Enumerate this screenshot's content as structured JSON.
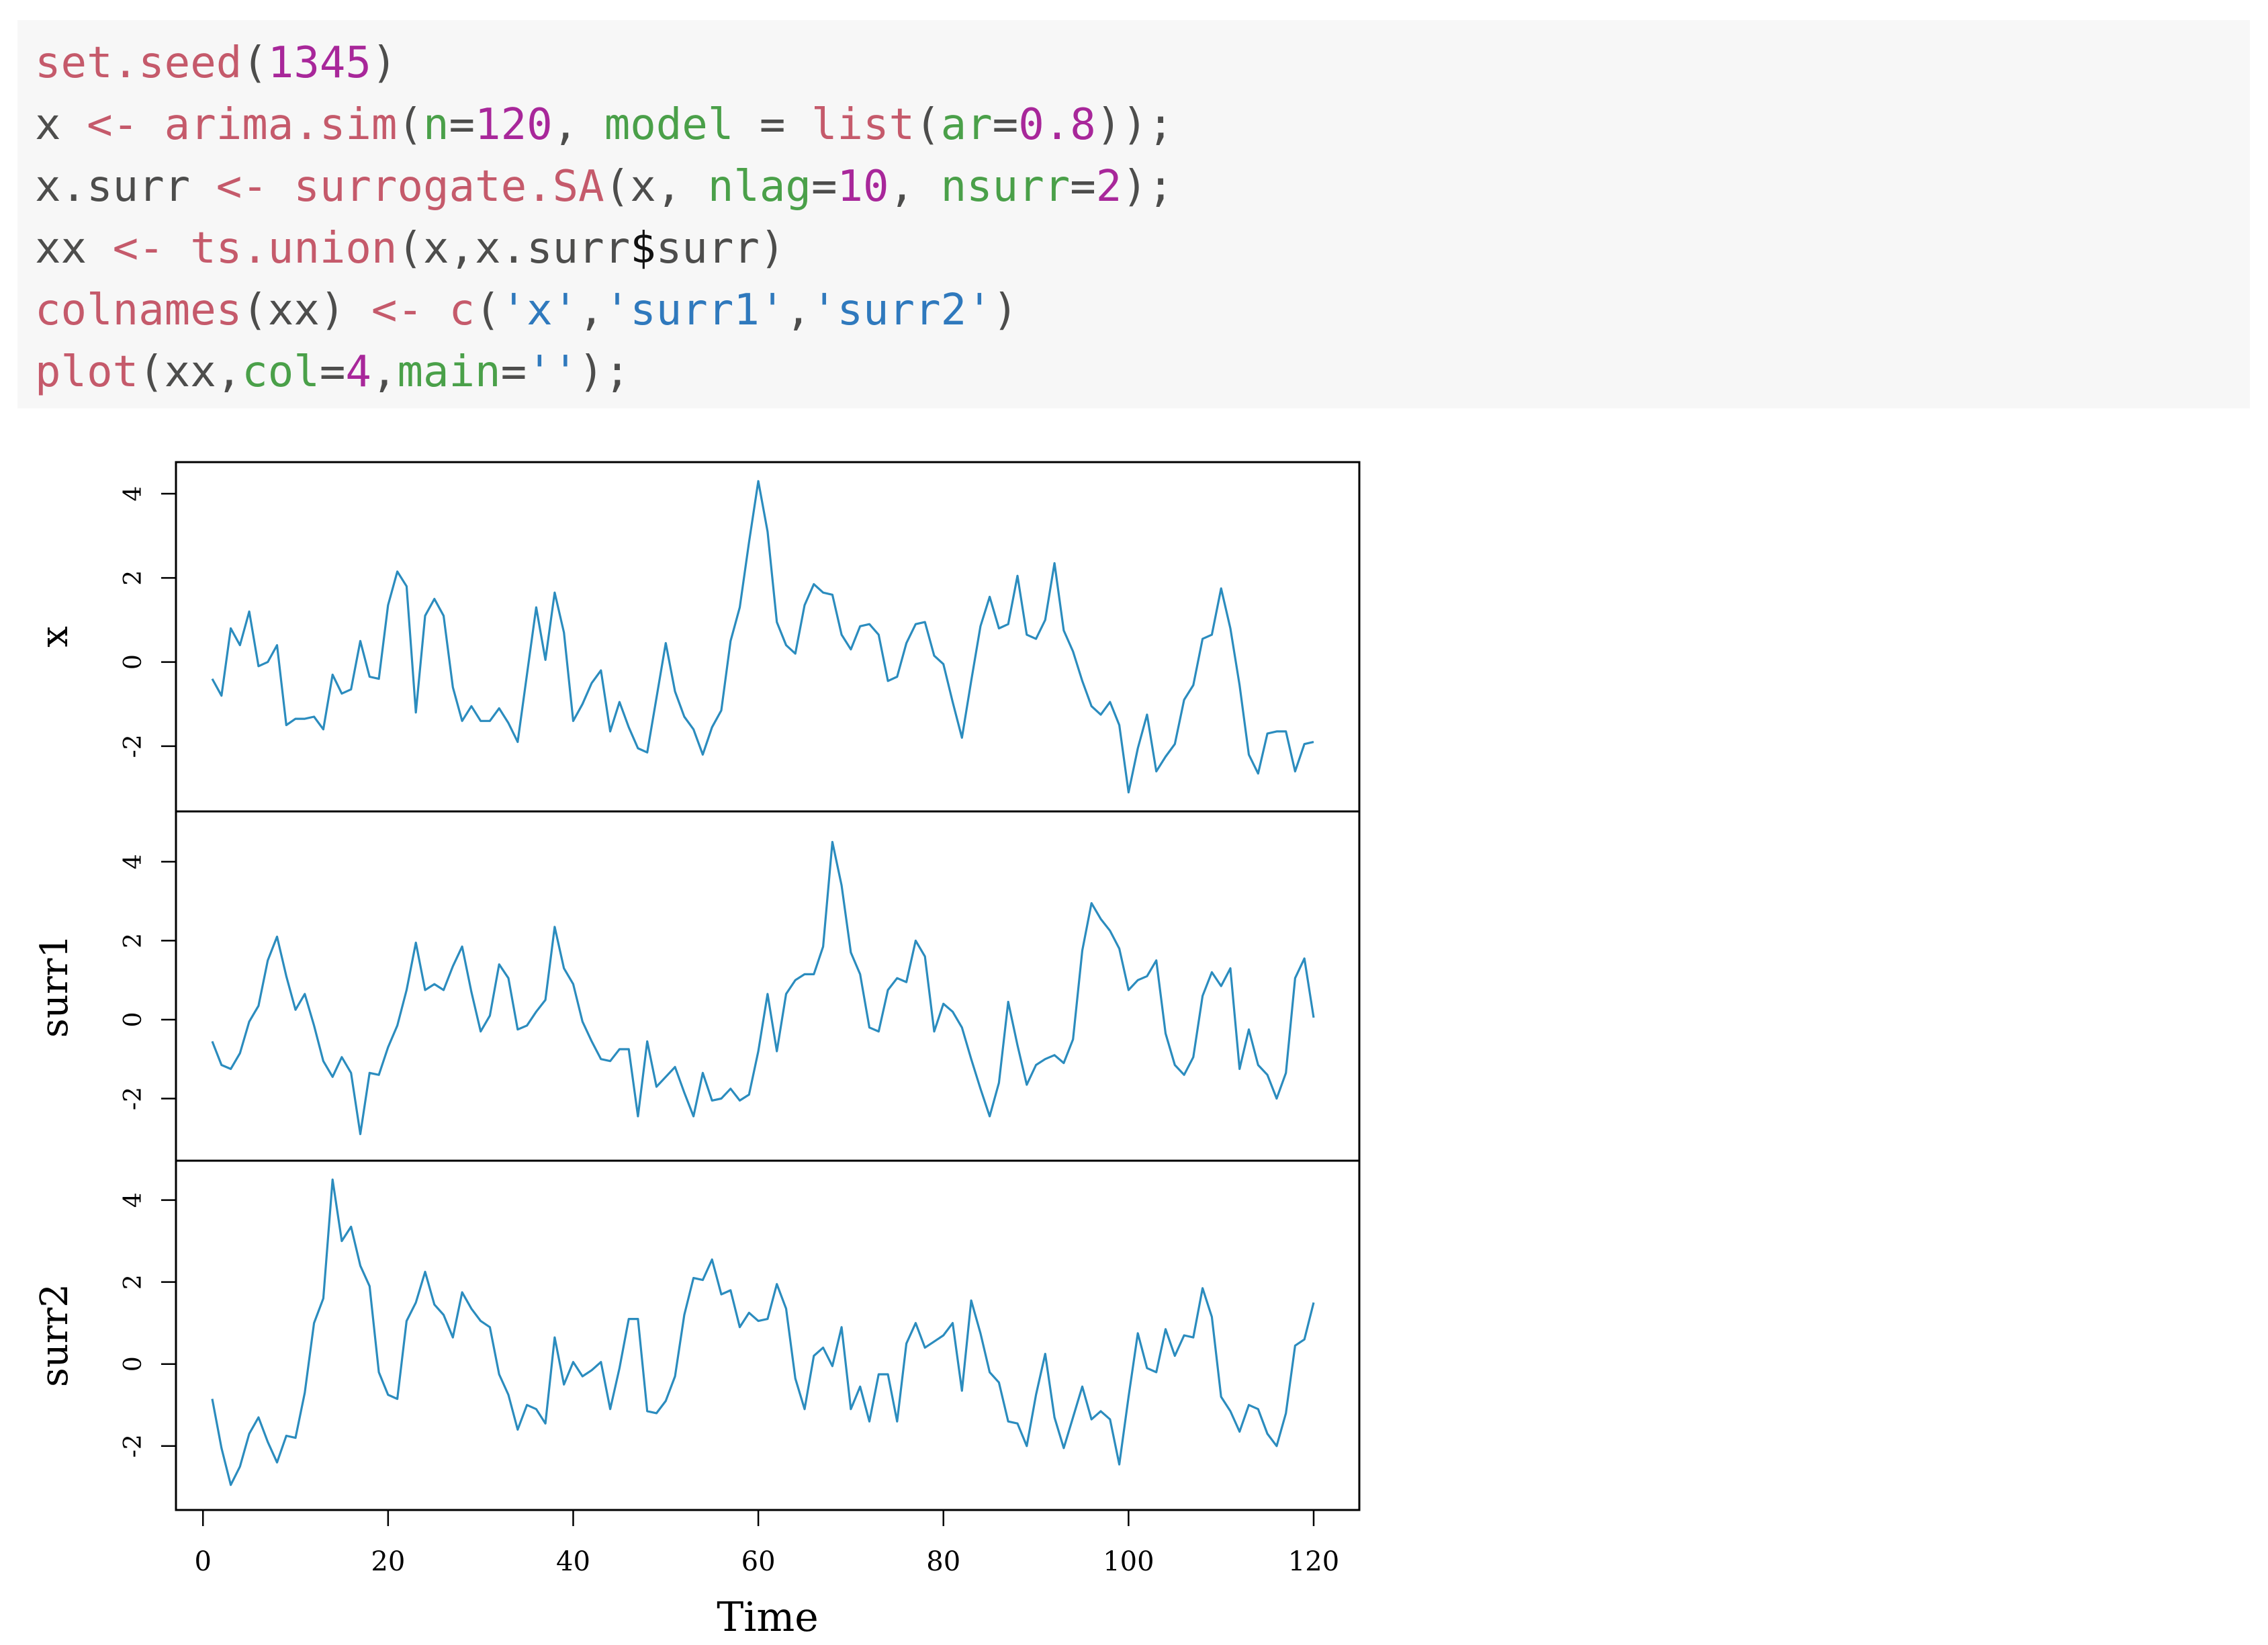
{
  "code": {
    "lines": [
      [
        {
          "t": "set.seed",
          "c": "fn"
        },
        {
          "t": "(",
          "c": "plain"
        },
        {
          "t": "1345",
          "c": "num"
        },
        {
          "t": ")",
          "c": "plain"
        }
      ],
      [
        {
          "t": "x ",
          "c": "plain"
        },
        {
          "t": "<-",
          "c": "op"
        },
        {
          "t": " ",
          "c": "plain"
        },
        {
          "t": "arima.sim",
          "c": "fn"
        },
        {
          "t": "(",
          "c": "plain"
        },
        {
          "t": "n",
          "c": "arg"
        },
        {
          "t": "=",
          "c": "plain"
        },
        {
          "t": "120",
          "c": "num"
        },
        {
          "t": ", ",
          "c": "plain"
        },
        {
          "t": "model",
          "c": "arg"
        },
        {
          "t": " = ",
          "c": "plain"
        },
        {
          "t": "list",
          "c": "fn"
        },
        {
          "t": "(",
          "c": "plain"
        },
        {
          "t": "ar",
          "c": "arg"
        },
        {
          "t": "=",
          "c": "plain"
        },
        {
          "t": "0.8",
          "c": "num"
        },
        {
          "t": "));",
          "c": "plain"
        }
      ],
      [
        {
          "t": "x.surr ",
          "c": "plain"
        },
        {
          "t": "<-",
          "c": "op"
        },
        {
          "t": " ",
          "c": "plain"
        },
        {
          "t": "surrogate.SA",
          "c": "fn"
        },
        {
          "t": "(x, ",
          "c": "plain"
        },
        {
          "t": "nlag",
          "c": "arg"
        },
        {
          "t": "=",
          "c": "plain"
        },
        {
          "t": "10",
          "c": "num"
        },
        {
          "t": ", ",
          "c": "plain"
        },
        {
          "t": "nsurr",
          "c": "arg"
        },
        {
          "t": "=",
          "c": "plain"
        },
        {
          "t": "2",
          "c": "num"
        },
        {
          "t": ");",
          "c": "plain"
        }
      ],
      [
        {
          "t": "xx ",
          "c": "plain"
        },
        {
          "t": "<-",
          "c": "op"
        },
        {
          "t": " ",
          "c": "plain"
        },
        {
          "t": "ts.union",
          "c": "fn"
        },
        {
          "t": "(x,x.surr",
          "c": "plain"
        },
        {
          "t": "$",
          "c": "dollar"
        },
        {
          "t": "surr)",
          "c": "plain"
        }
      ],
      [
        {
          "t": "colnames",
          "c": "fn"
        },
        {
          "t": "(xx) ",
          "c": "plain"
        },
        {
          "t": "<-",
          "c": "op"
        },
        {
          "t": " ",
          "c": "plain"
        },
        {
          "t": "c",
          "c": "fn"
        },
        {
          "t": "(",
          "c": "plain"
        },
        {
          "t": "'x'",
          "c": "str"
        },
        {
          "t": ",",
          "c": "plain"
        },
        {
          "t": "'surr1'",
          "c": "str"
        },
        {
          "t": ",",
          "c": "plain"
        },
        {
          "t": "'surr2'",
          "c": "str"
        },
        {
          "t": ")",
          "c": "plain"
        }
      ],
      [
        {
          "t": "plot",
          "c": "fn"
        },
        {
          "t": "(xx,",
          "c": "plain"
        },
        {
          "t": "col",
          "c": "arg"
        },
        {
          "t": "=",
          "c": "plain"
        },
        {
          "t": "4",
          "c": "num"
        },
        {
          "t": ",",
          "c": "plain"
        },
        {
          "t": "main",
          "c": "arg"
        },
        {
          "t": "=",
          "c": "plain"
        },
        {
          "t": "''",
          "c": "str"
        },
        {
          "t": ");",
          "c": "plain"
        }
      ]
    ]
  },
  "chart_data": {
    "type": "line",
    "title": "",
    "xlabel": "Time",
    "xlim": [
      1,
      120
    ],
    "x_ticks": [
      0,
      20,
      40,
      60,
      80,
      100,
      120
    ],
    "line_color": "#2B8CBE",
    "panels": [
      {
        "name": "x",
        "ylabel": "x",
        "ylim": [
          -3.2,
          4.4
        ],
        "y_ticks": [
          -2,
          0,
          2,
          4
        ],
        "values": [
          -0.4,
          -0.8,
          0.8,
          0.4,
          1.2,
          -0.1,
          0.0,
          0.4,
          -1.5,
          -1.35,
          -1.35,
          -1.3,
          -1.6,
          -0.3,
          -0.75,
          -0.65,
          0.5,
          -0.35,
          -0.4,
          1.35,
          2.15,
          1.8,
          -1.2,
          1.1,
          1.5,
          1.1,
          -0.6,
          -1.4,
          -1.05,
          -1.4,
          -1.4,
          -1.1,
          -1.45,
          -1.9,
          -0.3,
          1.3,
          0.05,
          1.65,
          0.7,
          -1.4,
          -1.0,
          -0.5,
          -0.2,
          -1.65,
          -0.95,
          -1.55,
          -2.05,
          -2.15,
          -0.85,
          0.45,
          -0.7,
          -1.3,
          -1.6,
          -2.2,
          -1.55,
          -1.15,
          0.5,
          1.3,
          2.85,
          4.3,
          3.1,
          0.95,
          0.4,
          0.2,
          1.35,
          1.85,
          1.65,
          1.6,
          0.65,
          0.3,
          0.85,
          0.9,
          0.65,
          -0.45,
          -0.35,
          0.45,
          0.9,
          0.95,
          0.15,
          -0.05,
          -0.95,
          -1.8,
          -0.45,
          0.85,
          1.55,
          0.8,
          0.9,
          2.05,
          0.65,
          0.55,
          1.0,
          2.35,
          0.75,
          0.25,
          -0.45,
          -1.05,
          -1.25,
          -0.95,
          -1.5,
          -3.1,
          -2.05,
          -1.25,
          -2.6,
          -2.25,
          -1.95,
          -0.9,
          -0.55,
          0.55,
          0.65,
          1.75,
          0.8,
          -0.55,
          -2.2,
          -2.65,
          -1.7,
          -1.65,
          -1.65,
          -2.6,
          -1.95,
          -1.9
        ]
      },
      {
        "name": "surr1",
        "ylabel": "surr1",
        "ylim": [
          -3.2,
          4.9
        ],
        "y_ticks": [
          -2,
          0,
          2,
          4
        ],
        "values": [
          -0.55,
          -1.15,
          -1.25,
          -0.85,
          -0.05,
          0.35,
          1.5,
          2.1,
          1.1,
          0.25,
          0.65,
          -0.15,
          -1.05,
          -1.45,
          -0.95,
          -1.35,
          -2.9,
          -1.35,
          -1.4,
          -0.7,
          -0.15,
          0.75,
          1.95,
          0.75,
          0.9,
          0.75,
          1.35,
          1.85,
          0.7,
          -0.3,
          0.1,
          1.4,
          1.05,
          -0.25,
          -0.15,
          0.2,
          0.5,
          2.35,
          1.3,
          0.9,
          -0.05,
          -0.55,
          -1.0,
          -1.05,
          -0.75,
          -0.75,
          -2.45,
          -0.55,
          -1.7,
          -1.45,
          -1.2,
          -1.85,
          -2.45,
          -1.35,
          -2.05,
          -2.0,
          -1.75,
          -2.05,
          -1.9,
          -0.8,
          0.65,
          -0.8,
          0.65,
          1.0,
          1.15,
          1.15,
          1.85,
          4.5,
          3.4,
          1.7,
          1.15,
          -0.2,
          -0.3,
          0.75,
          1.05,
          0.95,
          2.0,
          1.6,
          -0.3,
          0.4,
          0.2,
          -0.2,
          -1.0,
          -1.75,
          -2.45,
          -1.6,
          0.45,
          -0.65,
          -1.65,
          -1.15,
          -1.0,
          -0.9,
          -1.1,
          -0.5,
          1.75,
          2.95,
          2.55,
          2.25,
          1.8,
          0.75,
          1.0,
          1.1,
          1.5,
          -0.35,
          -1.15,
          -1.4,
          -0.95,
          0.6,
          1.2,
          0.85,
          1.3,
          -1.25,
          -0.25,
          -1.15,
          -1.4,
          -2.0,
          -1.35,
          1.05,
          1.55,
          0.05
        ]
      },
      {
        "name": "surr2",
        "ylabel": "surr2",
        "ylim": [
          -3.2,
          4.6
        ],
        "y_ticks": [
          -2,
          0,
          2,
          4
        ],
        "values": [
          -0.85,
          -2.05,
          -2.95,
          -2.5,
          -1.7,
          -1.3,
          -1.9,
          -2.4,
          -1.75,
          -1.8,
          -0.7,
          1.0,
          1.6,
          4.5,
          3.0,
          3.35,
          2.4,
          1.9,
          -0.2,
          -0.75,
          -0.85,
          1.05,
          1.5,
          2.25,
          1.45,
          1.2,
          0.65,
          1.75,
          1.35,
          1.05,
          0.9,
          -0.25,
          -0.75,
          -1.6,
          -1.0,
          -1.1,
          -1.45,
          0.65,
          -0.5,
          0.05,
          -0.3,
          -0.15,
          0.05,
          -1.1,
          -0.1,
          1.1,
          1.1,
          -1.15,
          -1.2,
          -0.9,
          -0.3,
          1.2,
          2.1,
          2.05,
          2.55,
          1.7,
          1.8,
          0.9,
          1.25,
          1.05,
          1.1,
          1.95,
          1.35,
          -0.35,
          -1.1,
          0.2,
          0.4,
          -0.05,
          0.9,
          -1.1,
          -0.55,
          -1.4,
          -0.25,
          -0.25,
          -1.4,
          0.5,
          1.0,
          0.4,
          0.55,
          0.7,
          1.0,
          -0.65,
          1.55,
          0.75,
          -0.2,
          -0.45,
          -1.4,
          -1.45,
          -2.0,
          -0.75,
          0.25,
          -1.3,
          -2.05,
          -1.3,
          -0.55,
          -1.35,
          -1.15,
          -1.35,
          -2.45,
          -0.8,
          0.75,
          -0.1,
          -0.2,
          0.85,
          0.2,
          0.7,
          0.65,
          1.85,
          1.15,
          -0.8,
          -1.15,
          -1.65,
          -1.0,
          -1.1,
          -1.7,
          -2.0,
          -1.2,
          0.45,
          0.6,
          1.5
        ]
      }
    ]
  }
}
